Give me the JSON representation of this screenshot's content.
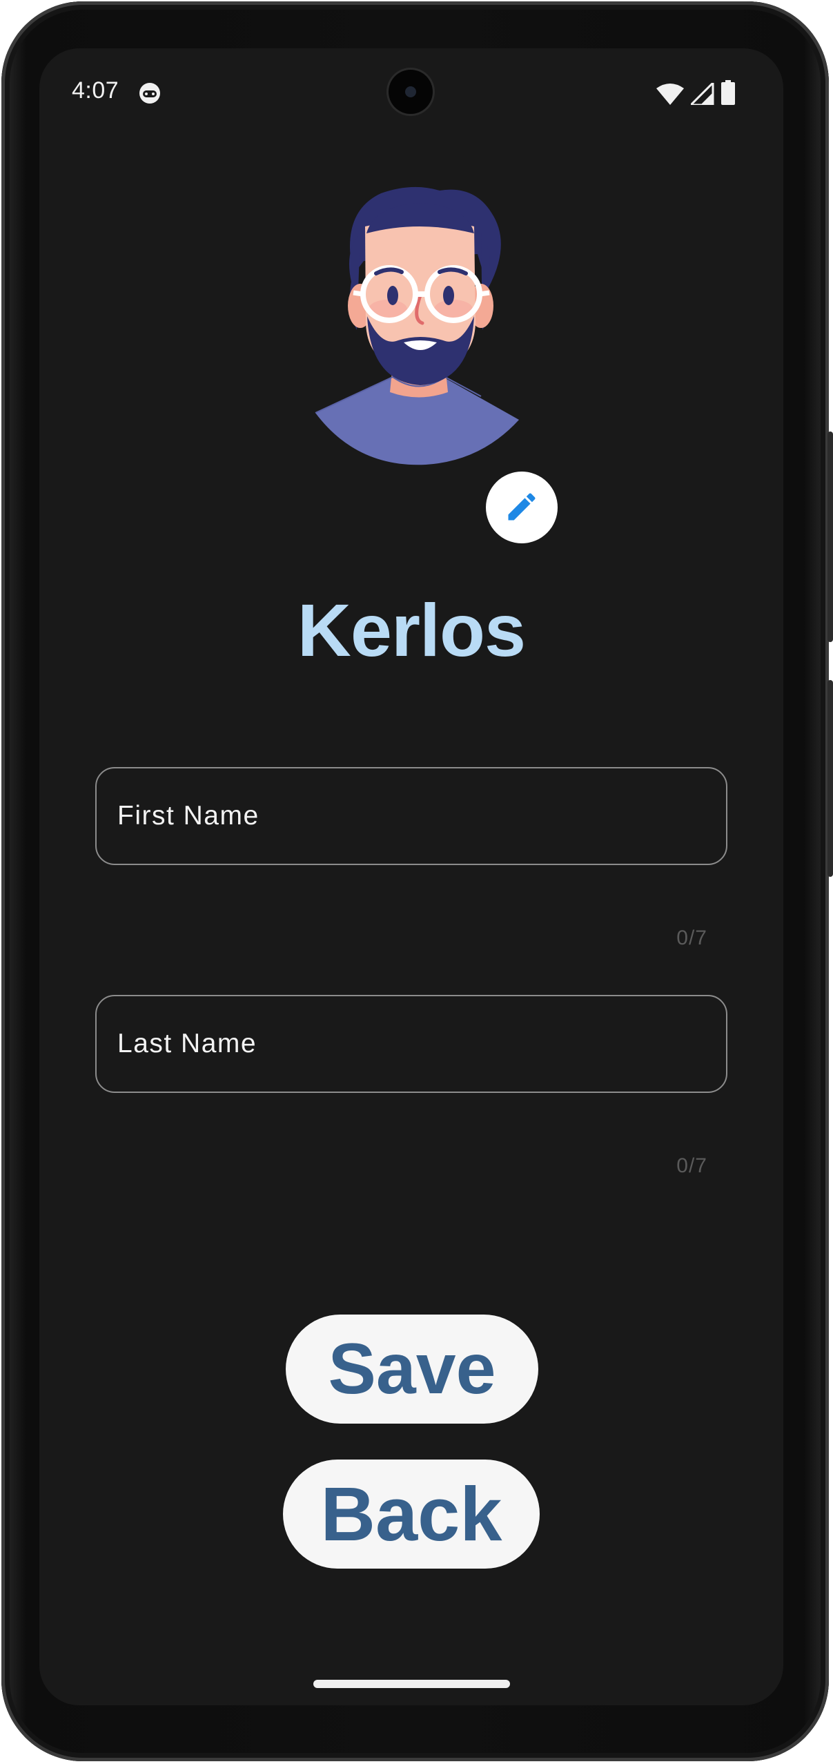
{
  "status_bar": {
    "time": "4:07",
    "icons": [
      "notification-cat-icon",
      "wifi-icon",
      "cellular-signal-icon",
      "battery-icon"
    ]
  },
  "profile": {
    "name": "Kerlos",
    "avatar": "bearded-man-avatar",
    "edit_icon": "pencil-icon"
  },
  "form": {
    "first_name": {
      "placeholder": "First Name",
      "value": "",
      "counter": "0/7"
    },
    "last_name": {
      "placeholder": "Last Name",
      "value": "",
      "counter": "0/7"
    }
  },
  "actions": {
    "save_label": "Save",
    "back_label": "Back"
  },
  "colors": {
    "background": "#191919",
    "title": "#b9dbf5",
    "button_bg": "#f6f6f6",
    "button_text": "#38618c",
    "edit_icon": "#1e88e5"
  }
}
